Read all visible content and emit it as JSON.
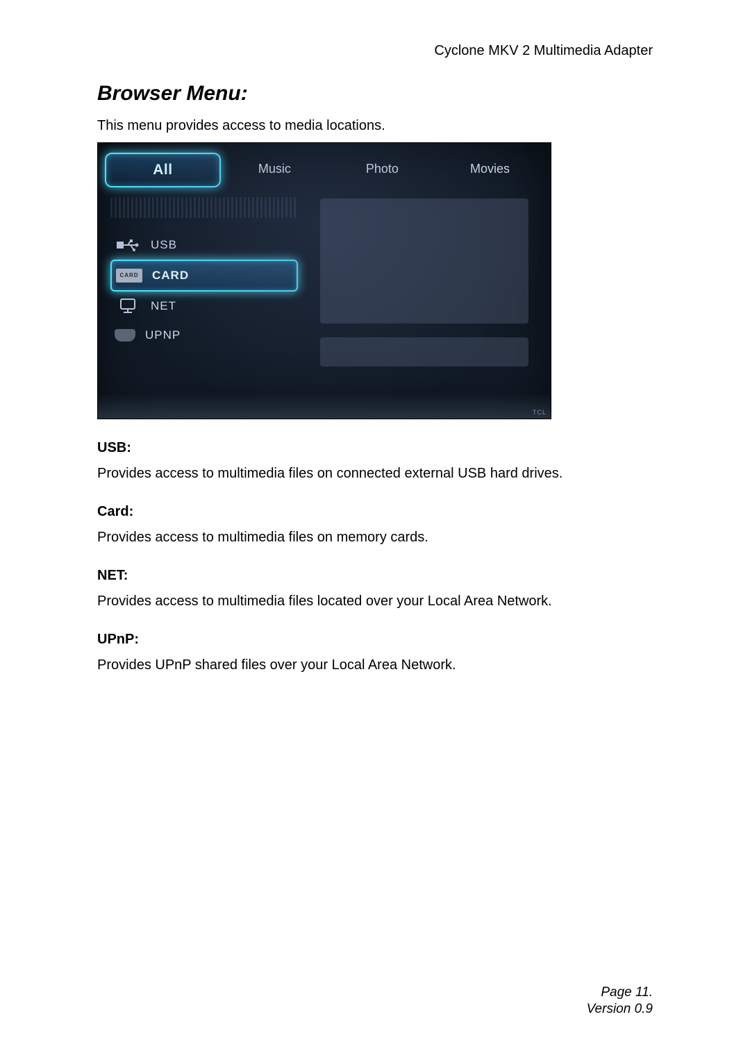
{
  "header": {
    "product": "Cyclone MKV 2 Multimedia Adapter"
  },
  "title": "Browser Menu:",
  "intro": "This menu provides access to media locations.",
  "screenshot": {
    "tabs": {
      "items": [
        {
          "label": "All",
          "selected": true
        },
        {
          "label": "Music",
          "selected": false
        },
        {
          "label": "Photo",
          "selected": false
        },
        {
          "label": "Movies",
          "selected": false
        }
      ]
    },
    "sources": {
      "items": [
        {
          "label": "USB",
          "icon": "usb-icon",
          "selected": false
        },
        {
          "label": "CARD",
          "icon": "card-icon",
          "selected": true
        },
        {
          "label": "NET",
          "icon": "net-icon",
          "selected": false
        },
        {
          "label": "UPNP",
          "icon": "disk-icon",
          "selected": false
        }
      ]
    },
    "brand": "TCL"
  },
  "sections": [
    {
      "heading": "USB:",
      "body": "Provides access to multimedia files on connected external USB hard drives."
    },
    {
      "heading": "Card:",
      "body": "Provides access to multimedia files on memory cards."
    },
    {
      "heading": "NET:",
      "body": "Provides access to multimedia files located over your Local Area Network."
    },
    {
      "heading": "UPnP:",
      "body": "Provides UPnP shared files over your Local Area Network."
    }
  ],
  "footer": {
    "page": "Page 11.",
    "version": "Version 0.9"
  },
  "card_chip_text": "CARD"
}
